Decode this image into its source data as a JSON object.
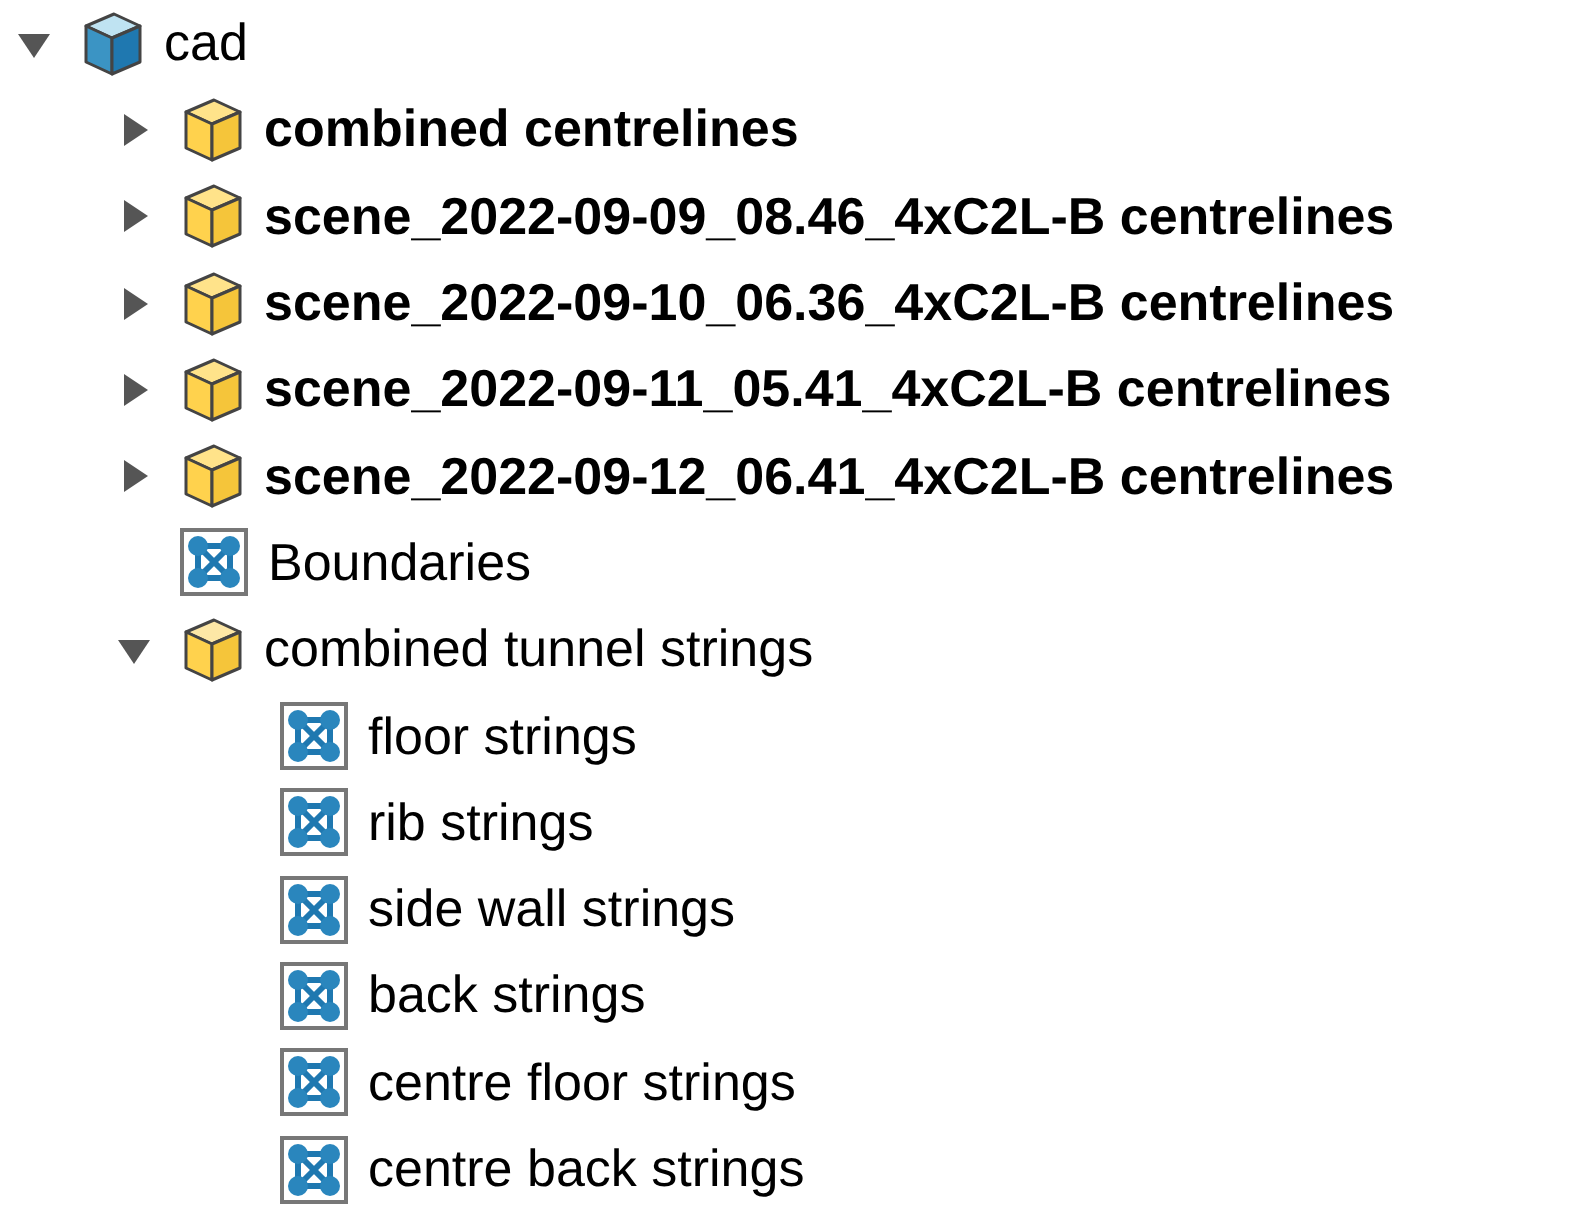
{
  "tree": [
    {
      "label": "cad",
      "kind": "model",
      "bold": false,
      "expanded": true,
      "children": [
        {
          "label": "combined centrelines",
          "kind": "layer",
          "bold": true,
          "expanded": false
        },
        {
          "label": "scene_2022-09-09_08.46_4xC2L-B centrelines",
          "kind": "layer",
          "bold": true,
          "expanded": false
        },
        {
          "label": "scene_2022-09-10_06.36_4xC2L-B centrelines",
          "kind": "layer",
          "bold": true,
          "expanded": false
        },
        {
          "label": "scene_2022-09-11_05.41_4xC2L-B centrelines",
          "kind": "layer",
          "bold": true,
          "expanded": false
        },
        {
          "label": "scene_2022-09-12_06.41_4xC2L-B centrelines",
          "kind": "layer",
          "bold": true,
          "expanded": false
        },
        {
          "label": "Boundaries",
          "kind": "strings",
          "bold": false
        },
        {
          "label": "combined tunnel strings",
          "kind": "layer",
          "bold": false,
          "expanded": true,
          "children": [
            {
              "label": "floor strings",
              "kind": "strings",
              "bold": false
            },
            {
              "label": "rib strings",
              "kind": "strings",
              "bold": false
            },
            {
              "label": "side wall strings",
              "kind": "strings",
              "bold": false
            },
            {
              "label": "back strings",
              "kind": "strings",
              "bold": false
            },
            {
              "label": "centre floor strings",
              "kind": "strings",
              "bold": false
            },
            {
              "label": "centre back strings",
              "kind": "strings",
              "bold": false
            }
          ]
        }
      ]
    }
  ]
}
